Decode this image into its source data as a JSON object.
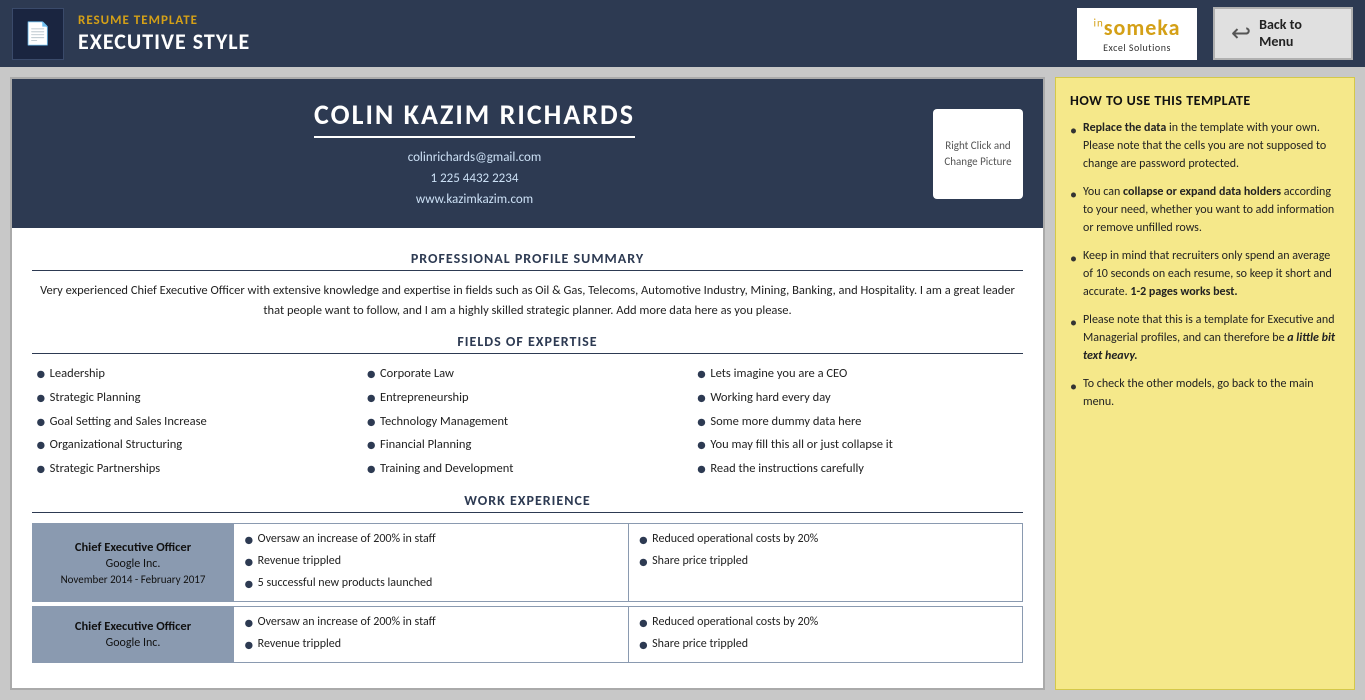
{
  "topbar": {
    "resume_template_label": "RESUME TEMPLATE",
    "executive_style_label": "EXECUTIVE STYLE",
    "someka_name": "someka",
    "someka_superscript": "in",
    "someka_tagline": "Excel Solutions",
    "back_button_label": "Back to\nMenu",
    "logo_icon": "📄"
  },
  "resume": {
    "candidate_name": "COLIN KAZIM RICHARDS",
    "email": "colinrichards@gmail.com",
    "phone": "1 225 4432 2234",
    "website": "www.kazimkazim.com",
    "photo_placeholder": "Right Click and\nChange Picture",
    "sections": {
      "profile_summary": {
        "title": "PROFESSIONAL PROFILE SUMMARY",
        "text": "Very experienced Chief Executive Officer with extensive knowledge and expertise in fields such as Oil & Gas, Telecoms, Automotive Industry, Mining, Banking, and Hospitality. I am a great leader that people want to follow, and I am a highly skilled strategic planner. Add more data here as you please."
      },
      "expertise": {
        "title": "FIELDS OF EXPERTISE",
        "items": [
          "Leadership",
          "Strategic Planning",
          "Goal Setting and Sales Increase",
          "Organizational Structuring",
          "Strategic Partnerships",
          "Corporate Law",
          "Entrepreneurship",
          "Technology Management",
          "Financial Planning",
          "Training and Development",
          "Lets imagine you are a CEO",
          "Working hard every day",
          "Some more dummy data here",
          "You may fill this all or just collapse it",
          "Read the instructions carefully"
        ]
      },
      "work_experience": {
        "title": "WORK EXPERIENCE",
        "jobs": [
          {
            "title": "Chief Executive Officer",
            "company": "Google Inc.",
            "dates": "November 2014 - February 2017",
            "details_left": [
              "Oversaw an increase of 200% in staff",
              "Revenue trippled",
              "5 successful new products launched"
            ],
            "details_right": [
              "Reduced operational costs by 20%",
              "Share price trippled"
            ]
          },
          {
            "title": "Chief Executive Officer",
            "company": "Google Inc.",
            "dates": "",
            "details_left": [
              "Oversaw an increase of 200% in staff",
              "Revenue trippled"
            ],
            "details_right": [
              "Reduced operational costs by 20%",
              "Share price trippled"
            ]
          }
        ]
      }
    }
  },
  "sidebar": {
    "title": "HOW TO USE THIS TEMPLATE",
    "items": [
      {
        "text_parts": [
          {
            "type": "bold",
            "text": "Replace the data"
          },
          {
            "type": "normal",
            "text": " in the template with your own. Please note that the cells you are not supposed to change are password protected."
          }
        ]
      },
      {
        "text_parts": [
          {
            "type": "normal",
            "text": "You can "
          },
          {
            "type": "bold",
            "text": "collapse or expand data holders"
          },
          {
            "type": "normal",
            "text": " according to your need, whether you want to add information or remove unfilled rows."
          }
        ]
      },
      {
        "text_parts": [
          {
            "type": "normal",
            "text": "Keep in mind that recruiters only spend an average of 10 seconds on each resume, so keep it short and accurate. "
          },
          {
            "type": "bold",
            "text": "1-2 pages works best."
          }
        ]
      },
      {
        "text_parts": [
          {
            "type": "normal",
            "text": "Please note that this is a template for Executive and Managerial profiles, and can therefore be "
          },
          {
            "type": "bold-italic",
            "text": "a little bit text heavy."
          }
        ]
      },
      {
        "text_parts": [
          {
            "type": "normal",
            "text": "To check the other models, go back to the main menu."
          }
        ]
      }
    ]
  }
}
